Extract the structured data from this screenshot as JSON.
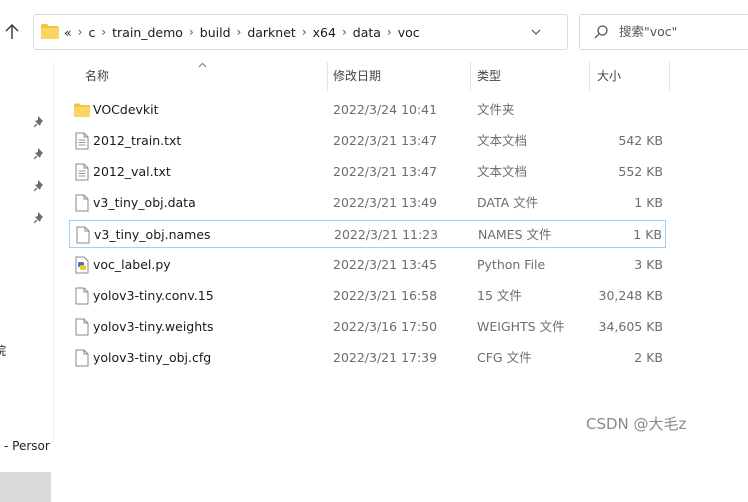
{
  "address_bar": {
    "overflow": "«",
    "crumbs": [
      "c",
      "train_demo",
      "build",
      "darknet",
      "x64",
      "data",
      "voc"
    ]
  },
  "search": {
    "placeholder": "搜索\"voc\""
  },
  "nav_pane": {
    "partial_item_1": "院",
    "partial_item_2": "- Persor"
  },
  "columns": {
    "name": "名称",
    "date": "修改日期",
    "type": "类型",
    "size": "大小"
  },
  "files": [
    {
      "name": "VOCdevkit",
      "date": "2022/3/24 10:41",
      "type": "文件夹",
      "size": "",
      "icon": "folder-icon"
    },
    {
      "name": "2012_train.txt",
      "date": "2022/3/21 13:47",
      "type": "文本文档",
      "size": "542 KB",
      "icon": "text-file-icon"
    },
    {
      "name": "2012_val.txt",
      "date": "2022/3/21 13:47",
      "type": "文本文档",
      "size": "552 KB",
      "icon": "text-file-icon"
    },
    {
      "name": "v3_tiny_obj.data",
      "date": "2022/3/21 13:49",
      "type": "DATA 文件",
      "size": "1 KB",
      "icon": "file-icon"
    },
    {
      "name": "v3_tiny_obj.names",
      "date": "2022/3/21 11:23",
      "type": "NAMES 文件",
      "size": "1 KB",
      "icon": "file-icon",
      "selected": true
    },
    {
      "name": "voc_label.py",
      "date": "2022/3/21 13:45",
      "type": "Python File",
      "size": "3 KB",
      "icon": "python-file-icon"
    },
    {
      "name": "yolov3-tiny.conv.15",
      "date": "2022/3/21 16:58",
      "type": "15 文件",
      "size": "30,248 KB",
      "icon": "file-icon"
    },
    {
      "name": "yolov3-tiny.weights",
      "date": "2022/3/16 17:50",
      "type": "WEIGHTS 文件",
      "size": "34,605 KB",
      "icon": "file-icon"
    },
    {
      "name": "yolov3-tiny_obj.cfg",
      "date": "2022/3/21 17:39",
      "type": "CFG 文件",
      "size": "2 KB",
      "icon": "file-icon"
    }
  ],
  "watermark": "CSDN @大毛z"
}
